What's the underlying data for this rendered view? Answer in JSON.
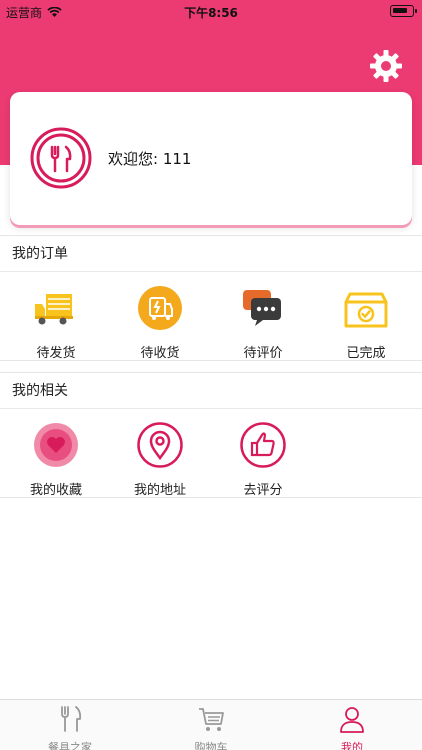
{
  "status_bar": {
    "carrier": "运营商",
    "time": "下午8:56",
    "battery_level": 0.8
  },
  "profile": {
    "welcome_text": "欢迎您: 111"
  },
  "orders": {
    "title": "我的订单",
    "items": [
      {
        "label": "待发货",
        "icon": "delivery-truck-icon"
      },
      {
        "label": "待收货",
        "icon": "receive-package-icon"
      },
      {
        "label": "待评价",
        "icon": "review-chat-icon"
      },
      {
        "label": "已完成",
        "icon": "completed-box-icon"
      }
    ]
  },
  "related": {
    "title": "我的相关",
    "items": [
      {
        "label": "我的收藏",
        "icon": "heart-icon"
      },
      {
        "label": "我的地址",
        "icon": "location-pin-icon"
      },
      {
        "label": "去评分",
        "icon": "thumbs-up-icon"
      }
    ]
  },
  "tabbar": {
    "items": [
      {
        "label": "餐具之家",
        "icon": "fork-knife-icon",
        "active": false
      },
      {
        "label": "购物车",
        "icon": "cart-icon",
        "active": false
      },
      {
        "label": "我的",
        "icon": "person-icon",
        "active": true
      }
    ]
  },
  "colors": {
    "brand": "#ec3a73",
    "accent_pink": "#d81b5b",
    "truck_yellow": "#f8c31c",
    "receive_orange": "#f3a91b"
  }
}
